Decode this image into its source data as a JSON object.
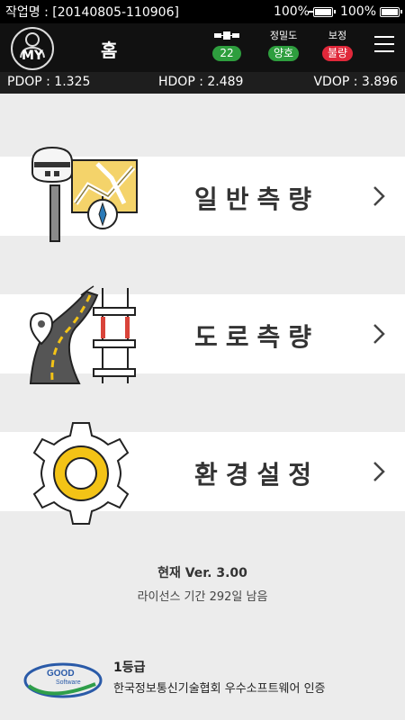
{
  "status_bar": {
    "job_label": "작업명 : [20140805-110906]",
    "battery_device": "100%",
    "battery_gnss": "100%"
  },
  "header": {
    "my_label": "MY",
    "title": "홈",
    "satellite": {
      "count": "22",
      "color": "#2e9e3e",
      "icon": "satellite-icon"
    },
    "precision": {
      "label": "정밀도",
      "value": "양호",
      "color": "#2e9e3e"
    },
    "correction": {
      "label": "보정",
      "value": "불량",
      "color": "#e0283a"
    },
    "menu_icon": "hamburger-menu-icon"
  },
  "dop": {
    "pdop": "PDOP : 1.325",
    "hdop": "HDOP : 2.489",
    "vdop": "VDOP : 3.896"
  },
  "menu": [
    {
      "label": "일반측량",
      "icon": "gnss-receiver-map-compass-illustration"
    },
    {
      "label": "도로측량",
      "icon": "road-survey-illustration"
    },
    {
      "label": "환경설정",
      "icon": "settings-gear-illustration"
    }
  ],
  "footer": {
    "version": "현재 Ver. 3.00",
    "license": "라이선스 기간  292일 남음",
    "logo_text_top": "GOOD",
    "logo_text_bottom": "Software",
    "grade": "1등급",
    "certification": "한국정보통신기술협회 우수소프트웨어 인증"
  },
  "colors": {
    "good": "#2e9e3e",
    "bad": "#e0283a",
    "gear_yellow": "#f3c316",
    "background": "#ececec"
  }
}
